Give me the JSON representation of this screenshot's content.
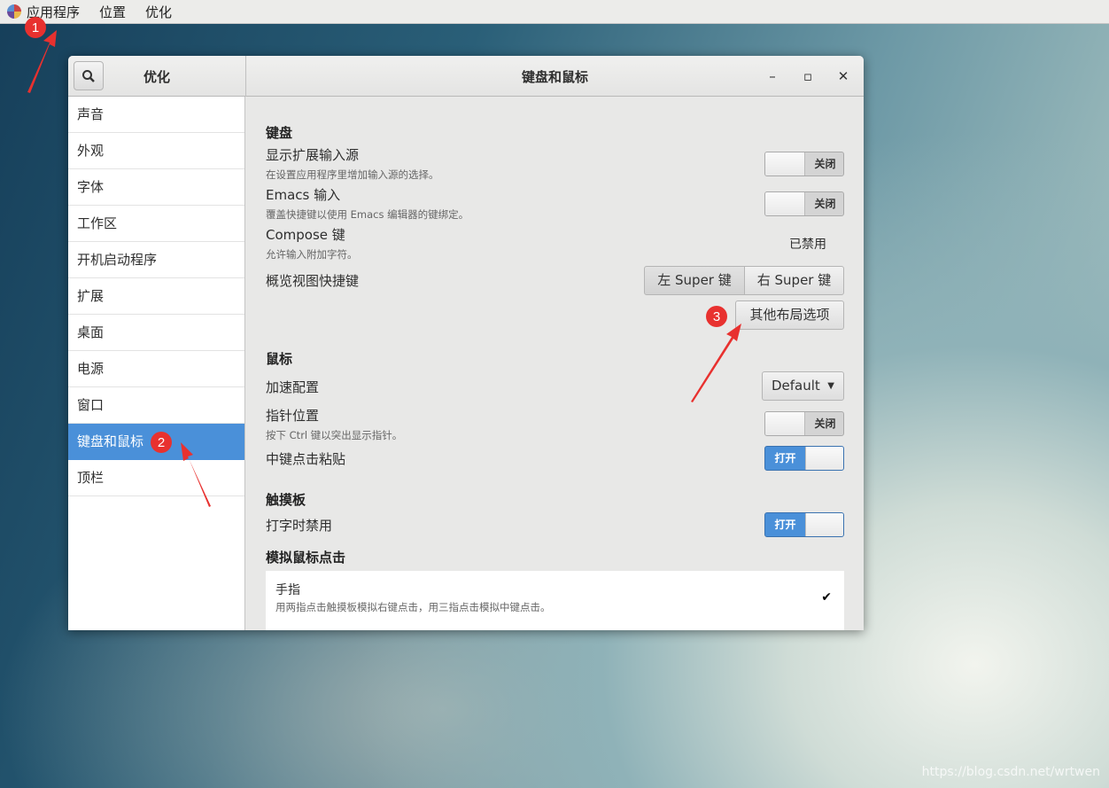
{
  "topbar": {
    "items": [
      "应用程序",
      "位置",
      "优化"
    ]
  },
  "window": {
    "sidebar_title": "优化",
    "title": "键盘和鼠标",
    "minimize": "–",
    "maximize": "▫",
    "close": "✕"
  },
  "sidebar": {
    "items": [
      "声音",
      "外观",
      "字体",
      "工作区",
      "开机启动程序",
      "扩展",
      "桌面",
      "电源",
      "窗口",
      "键盘和鼠标",
      "顶栏"
    ],
    "active": "键盘和鼠标"
  },
  "keyboard": {
    "heading": "键盘",
    "ext_sources": {
      "label": "显示扩展输入源",
      "desc": "在设置应用程序里增加输入源的选择。",
      "state": "关闭"
    },
    "emacs": {
      "label": "Emacs 输入",
      "desc": "覆盖快捷键以使用  Emacs 编辑器的键绑定。",
      "state": "关闭"
    },
    "compose": {
      "label": "Compose 键",
      "desc": "允许输入附加字符。",
      "value": "已禁用"
    },
    "overview": {
      "label": "概览视图快捷键",
      "left": "左  Super 键",
      "right": "右  Super 键"
    },
    "more_layout": "其他布局选项"
  },
  "mouse": {
    "heading": "鼠标",
    "accel": {
      "label": "加速配置",
      "value": "Default"
    },
    "pointer": {
      "label": "指针位置",
      "desc": "按下  Ctrl 键以突出显示指针。",
      "state": "关闭"
    },
    "middle": {
      "label": "中键点击粘贴",
      "state": "打开"
    }
  },
  "touchpad": {
    "heading": "触摸板",
    "disable_typing": {
      "label": "打字时禁用",
      "state": "打开"
    }
  },
  "emulate": {
    "heading": "模拟鼠标点击",
    "finger": {
      "label": "手指",
      "desc": "用两指点击触摸板模拟右键点击，用三指点击模拟中键点击。",
      "check": "✔"
    }
  },
  "annotations": [
    "1",
    "2",
    "3"
  ],
  "watermark": "https://blog.csdn.net/wrtwen",
  "colors": {
    "accent": "#4a90d9",
    "annotation": "#e8312f"
  }
}
